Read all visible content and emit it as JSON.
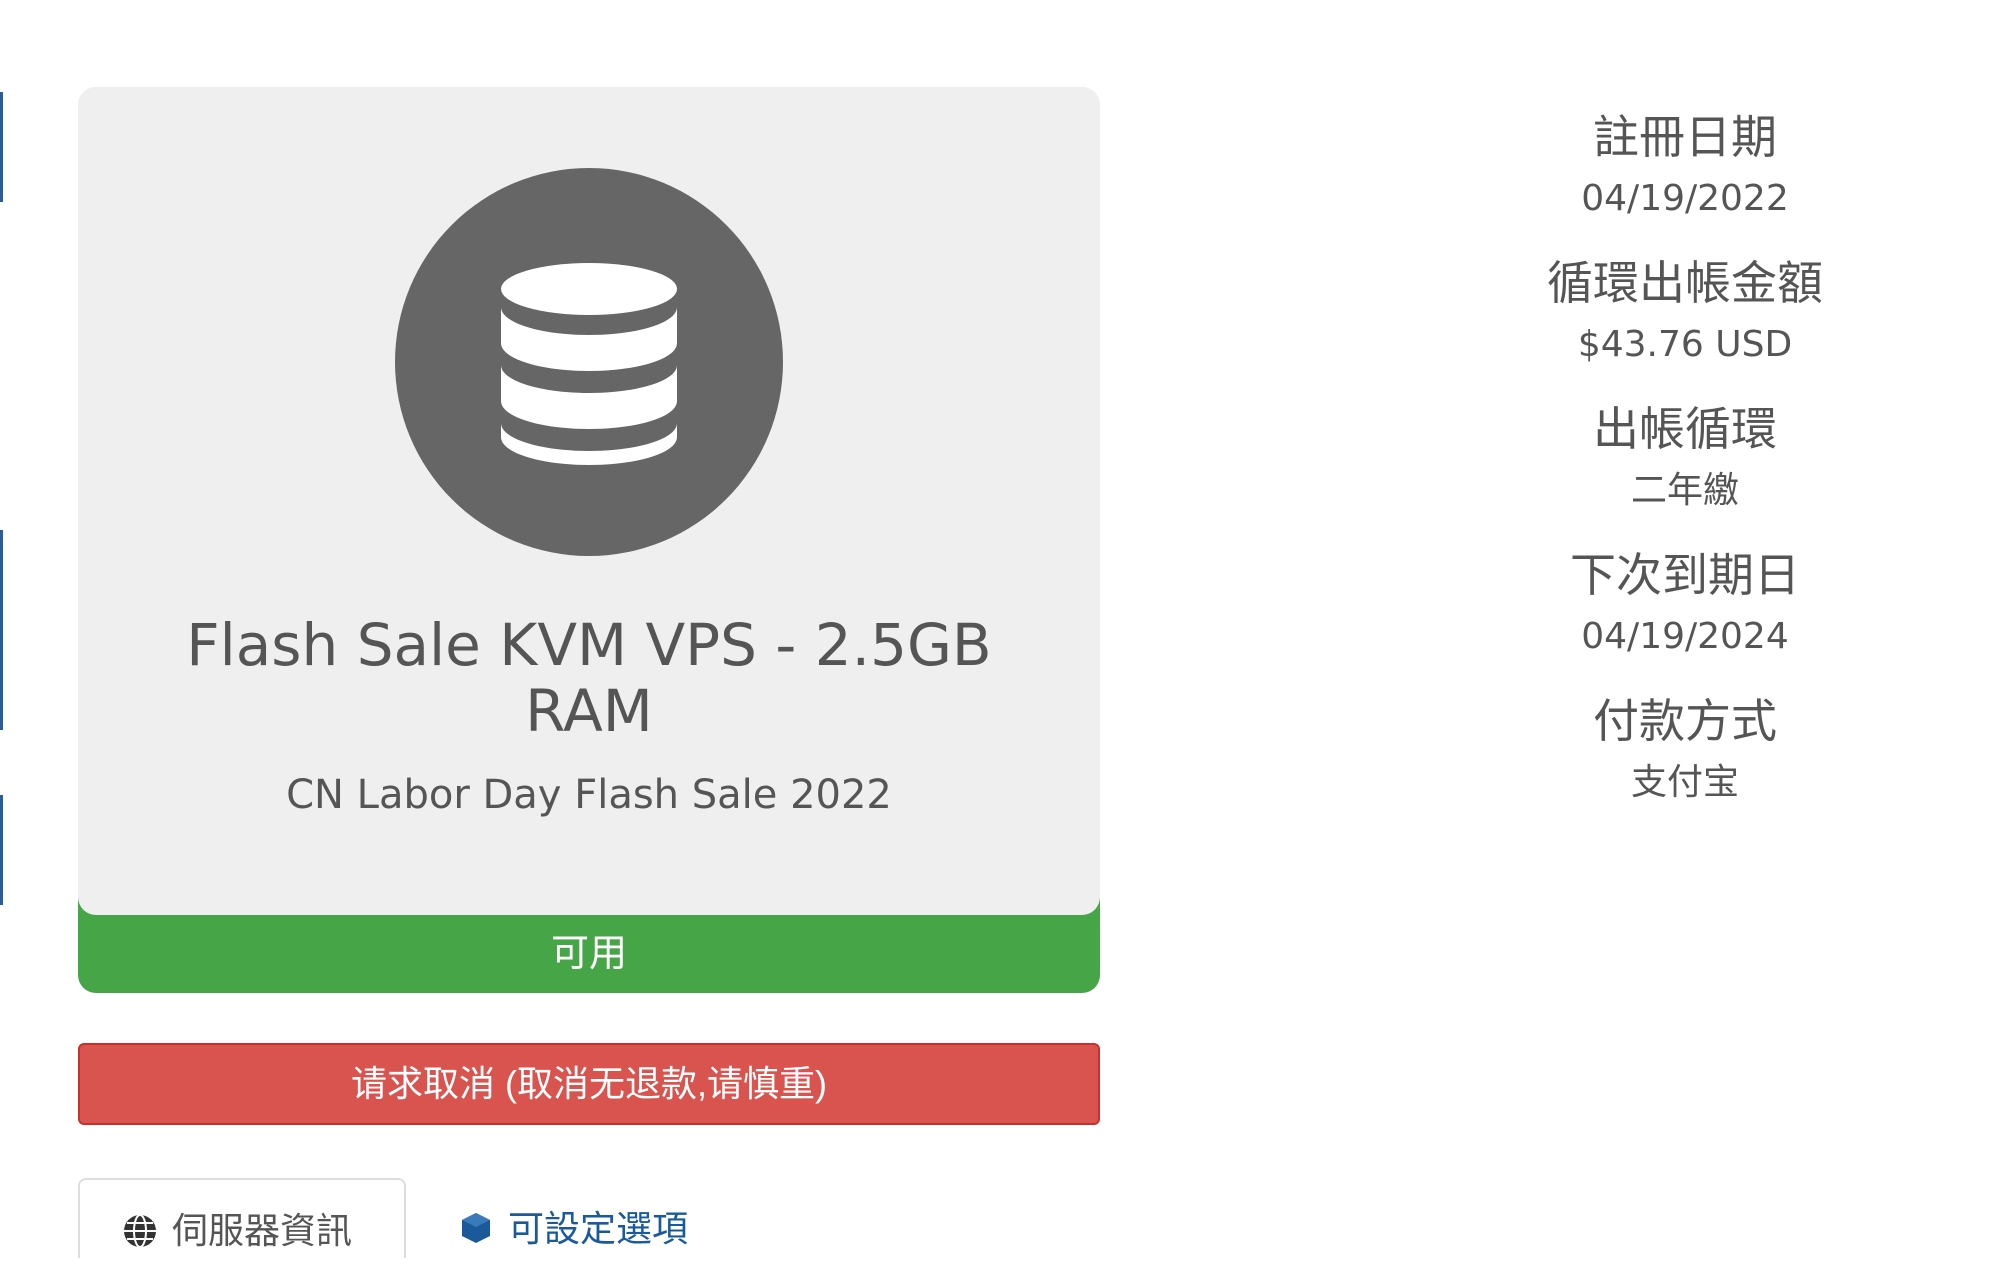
{
  "product": {
    "name": "Flash Sale KVM VPS - 2.5GB RAM",
    "group": "CN Labor Day Flash Sale 2022",
    "status": "可用",
    "icon": "database-icon"
  },
  "actions": {
    "cancel_label": "请求取消 (取消无退款,请慎重)"
  },
  "tabs": [
    {
      "label": "伺服器資訊",
      "icon": "globe-icon"
    },
    {
      "label": "可設定選項",
      "icon": "cubes-icon"
    }
  ],
  "details": [
    {
      "label": "註冊日期",
      "value": "04/19/2022"
    },
    {
      "label": "循環出帳金額",
      "value": "$43.76 USD"
    },
    {
      "label": "出帳循環",
      "value": "二年繳"
    },
    {
      "label": "下次到期日",
      "value": "04/19/2024"
    },
    {
      "label": "付款方式",
      "value": "支付宝"
    }
  ],
  "colors": {
    "status_active": "#46a546",
    "cancel_button": "#d9534f",
    "card_background": "#efefef",
    "icon_circle": "#666666",
    "link": "#1a5a9a"
  }
}
